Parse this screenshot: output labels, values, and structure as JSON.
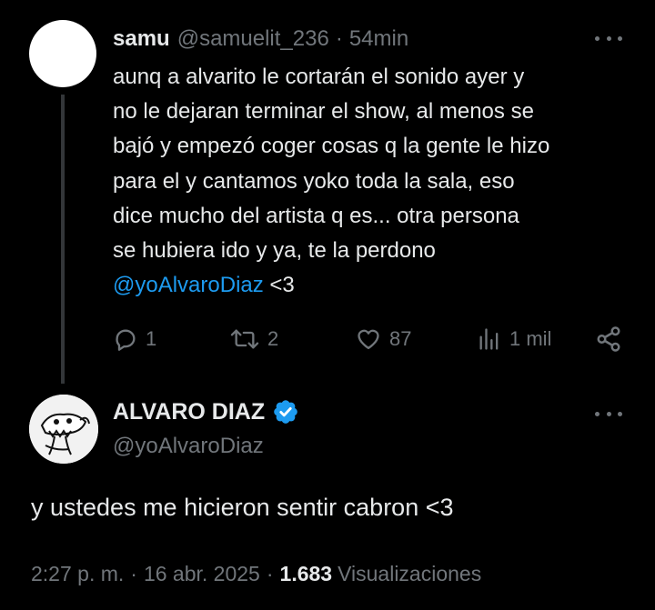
{
  "reply_tweet": {
    "author_name": "samu",
    "author_handle": "@samuelit_236",
    "separator": "·",
    "time_ago": "54min",
    "text_lines": [
      "aunq a alvarito le cortarán el sonido ayer y",
      "no le dejaran terminar el show, al menos se",
      "bajó y empezó coger cosas q la gente le hizo",
      "para el y cantamos yoko toda la sala, eso",
      "dice mucho del artista q es... otra persona",
      "se hubiera ido y ya, te la perdono"
    ],
    "mention": "@yoAlvaroDiaz",
    "text_suffix": " <3",
    "actions": {
      "replies": "1",
      "retweets": "2",
      "likes": "87",
      "views": "1 mil"
    },
    "avatar_color": "#ffffff"
  },
  "main_tweet": {
    "author_name": "ALVARO DIAZ",
    "author_handle": "@yoAlvaroDiaz",
    "verified": true,
    "text": "y ustedes me hicieron sentir cabron <3",
    "time": "2:27 p. m.",
    "separator": "·",
    "date": "16 abr. 2025",
    "views_count": "1.683",
    "views_label": "Visualizaciones"
  },
  "colors": {
    "background": "#000000",
    "text_primary": "#e7e9ea",
    "text_secondary": "#71767b",
    "accent": "#1d9bf0",
    "thread_line": "#333639"
  },
  "icons": {
    "reply": "reply-icon",
    "retweet": "retweet-icon",
    "like": "heart-icon",
    "views": "views-chart-icon",
    "share": "share-icon",
    "more": "more-dots-icon",
    "verified": "verified-badge-icon"
  }
}
